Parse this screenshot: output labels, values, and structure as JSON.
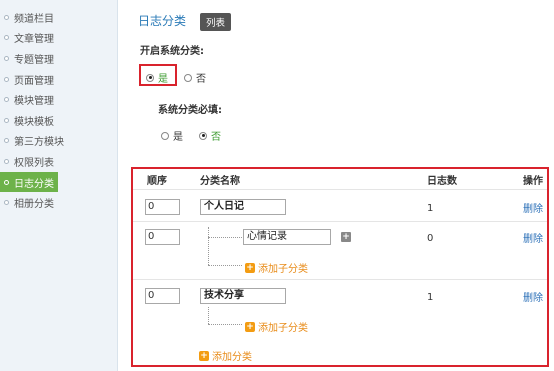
{
  "sidebar": {
    "items": [
      {
        "label": "频道栏目"
      },
      {
        "label": "文章管理"
      },
      {
        "label": "专题管理"
      },
      {
        "label": "页面管理"
      },
      {
        "label": "模块管理"
      },
      {
        "label": "模块模板"
      },
      {
        "label": "第三方模块"
      },
      {
        "label": "权限列表"
      },
      {
        "label": "日志分类"
      },
      {
        "label": "相册分类"
      }
    ],
    "active_index": 8
  },
  "header": {
    "title": "日志分类",
    "tab_list": "列表"
  },
  "settings": {
    "enable_label": "开启系统分类:",
    "enable_yes": "是",
    "enable_no": "否",
    "required_label": "系统分类必填:",
    "required_yes": "是",
    "required_no": "否"
  },
  "table": {
    "headers": {
      "order": "顺序",
      "name": "分类名称",
      "count": "日志数",
      "action": "操作"
    },
    "rows": [
      {
        "order": "0",
        "name": "个人日记",
        "count": "1",
        "action": "删除"
      },
      {
        "order": "0",
        "name": "心情记录",
        "count": "0",
        "action": "删除"
      },
      {
        "order": "0",
        "name": "技术分享",
        "count": "1",
        "action": "删除"
      }
    ],
    "add_child_label": "添加子分类",
    "add_category_label": "添加分类"
  },
  "colors": {
    "accent_blue": "#2a7ab7",
    "active_green": "#6db24a",
    "highlight_red": "#d9232d",
    "add_orange": "#e88c1a"
  }
}
